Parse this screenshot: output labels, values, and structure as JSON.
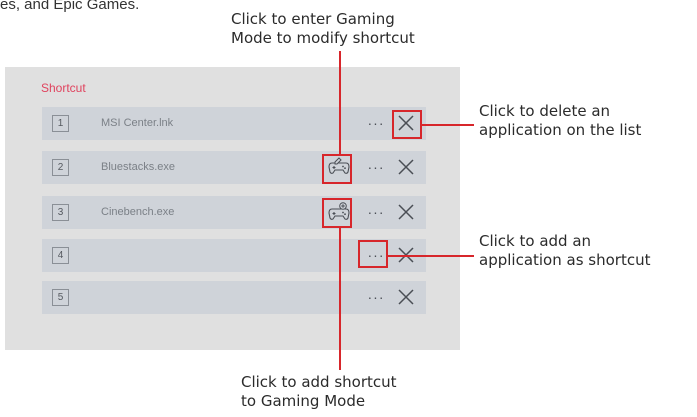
{
  "top_fragment": "es, and Epic Games.",
  "panel": {
    "title": "Shortcut",
    "rows": [
      {
        "num": "1",
        "file": "MSI Center.lnk",
        "game_icon": ""
      },
      {
        "num": "2",
        "file": "Bluestacks.exe",
        "game_icon": "gamepad-edit-icon"
      },
      {
        "num": "3",
        "file": "Cinebench.exe",
        "game_icon": "gamepad-add-icon"
      },
      {
        "num": "4",
        "file": "",
        "game_icon": ""
      },
      {
        "num": "5",
        "file": "",
        "game_icon": ""
      }
    ],
    "more_label": "···",
    "accent_color": "#e0435e",
    "highlight_color": "#d7262b"
  },
  "callouts": {
    "enter_gaming": "Click to enter Gaming\nMode to modify shortcut",
    "delete_app": "Click to delete an\napplication on the list",
    "add_app": "Click to add an\napplication as shortcut",
    "add_to_gaming": "Click to add shortcut\nto Gaming Mode"
  }
}
